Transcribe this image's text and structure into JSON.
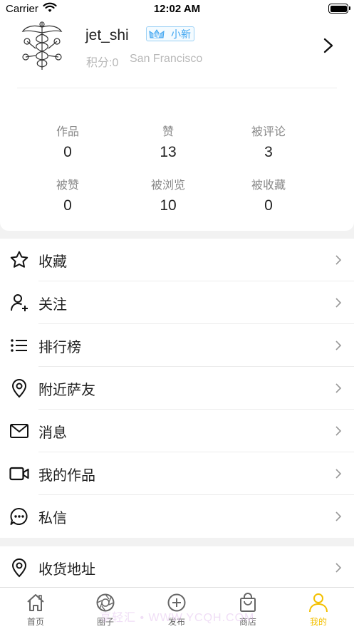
{
  "status_bar": {
    "carrier": "Carrier",
    "time": "12:02 AM"
  },
  "profile": {
    "username": "jet_shi",
    "level_badge": "小新",
    "points": "积分:0",
    "city": "San Francisco"
  },
  "stats": [
    {
      "label": "作品",
      "value": "0"
    },
    {
      "label": "赞",
      "value": "13"
    },
    {
      "label": "被评论",
      "value": "3"
    },
    {
      "label": "被赞",
      "value": "0"
    },
    {
      "label": "被浏览",
      "value": "10"
    },
    {
      "label": "被收藏",
      "value": "0"
    }
  ],
  "menu": {
    "items": [
      {
        "label": "收藏",
        "icon": "star-icon"
      },
      {
        "label": "关注",
        "icon": "user-plus-icon"
      },
      {
        "label": "排行榜",
        "icon": "list-icon"
      },
      {
        "label": "附近萨友",
        "icon": "location-pin-icon"
      },
      {
        "label": "消息",
        "icon": "mail-icon"
      },
      {
        "label": "我的作品",
        "icon": "video-camera-icon"
      },
      {
        "label": "私信",
        "icon": "chat-bubble-icon"
      }
    ],
    "address": {
      "label": "收货地址",
      "icon": "location-pin-icon"
    }
  },
  "tab_bar": {
    "tabs": [
      {
        "label": "首页",
        "icon": "home-icon"
      },
      {
        "label": "圈子",
        "icon": "aperture-icon"
      },
      {
        "label": "发布",
        "icon": "plus-circle-icon"
      },
      {
        "label": "商店",
        "icon": "shopping-bag-icon"
      },
      {
        "label": "我的",
        "icon": "person-icon",
        "active": true
      }
    ],
    "watermark": "享轻汇 • WWW.YCQH.COM"
  },
  "colors": {
    "accent": "#f3c000",
    "badge_blue": "#3aa3f0",
    "muted_text": "#b8b8b8",
    "background": "#f2f2f2"
  }
}
